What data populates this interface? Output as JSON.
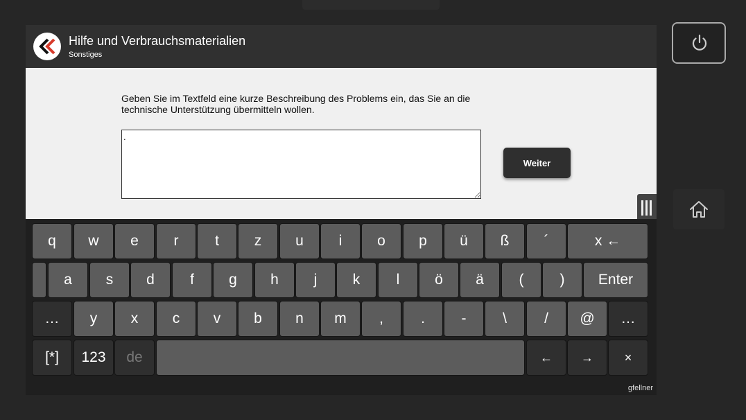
{
  "header": {
    "title": "Hilfe und Verbrauchsmaterialien",
    "subtitle": "Sonstiges"
  },
  "content": {
    "instructions": "Geben Sie im Textfeld eine kurze Beschreibung des Problems ein, das Sie an die technische Unterstützung übermitteln wollen.",
    "textarea_value": ".",
    "next_button_label": "Weiter"
  },
  "keyboard": {
    "rows": [
      [
        "q",
        "w",
        "e",
        "r",
        "t",
        "z",
        "u",
        "i",
        "o",
        "p",
        "ü",
        "ß",
        "´",
        "x ←"
      ],
      [
        "a",
        "s",
        "d",
        "f",
        "g",
        "h",
        "j",
        "k",
        "l",
        "ö",
        "ä",
        "(",
        ")",
        "Enter"
      ],
      [
        "…",
        "y",
        "x",
        "c",
        "v",
        "b",
        "n",
        "m",
        ",",
        ".",
        "-",
        "\\",
        "/",
        "@",
        "…"
      ],
      [
        "[*]",
        "123",
        "de",
        "",
        "←",
        "→",
        "×"
      ]
    ]
  },
  "user": "gfellner",
  "icons": {
    "back": "double-chevron-left-icon",
    "power": "power-icon",
    "home": "home-icon",
    "keyboard_handle": "keyboard-handle-icon"
  },
  "colors": {
    "accent": "#d63a2a",
    "key": "#5c5c5c",
    "key_dark": "#2f2f2f"
  }
}
